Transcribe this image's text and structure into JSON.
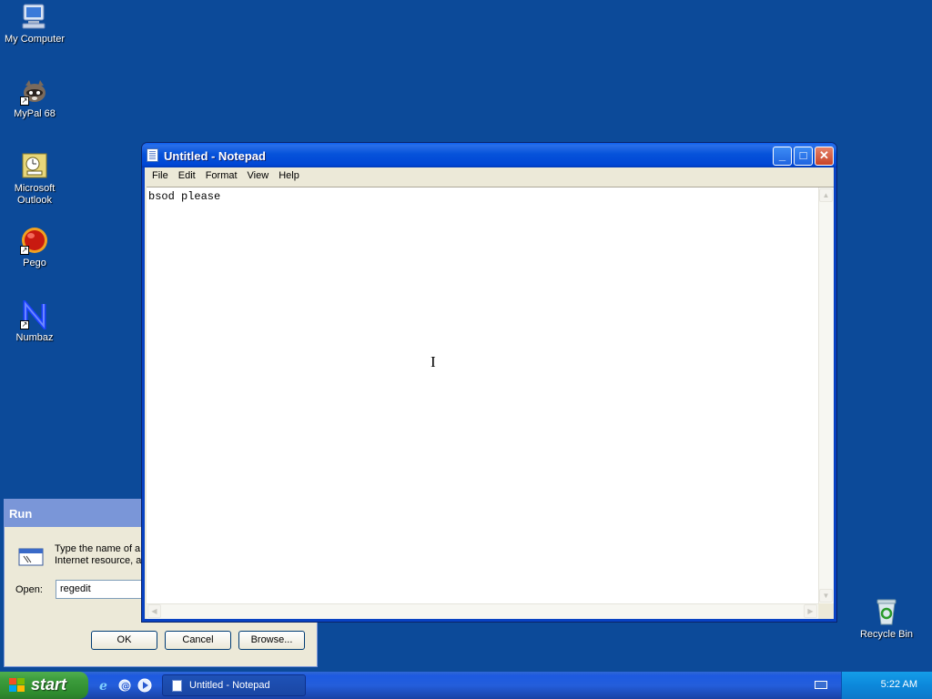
{
  "desktop": {
    "icons": [
      {
        "label": "My Computer"
      },
      {
        "label": "MyPal 68"
      },
      {
        "label": "Microsoft Outlook"
      },
      {
        "label": "Pego"
      },
      {
        "label": "Numbaz"
      },
      {
        "label": "Recycle Bin"
      }
    ]
  },
  "run_dialog": {
    "title": "Run",
    "description_line1": "Type the name of a",
    "description_line2": "Internet resource, a",
    "open_label": "Open:",
    "open_value": "regedit",
    "ok_label": "OK",
    "cancel_label": "Cancel",
    "browse_label": "Browse..."
  },
  "notepad": {
    "title": "Untitled - Notepad",
    "menu": [
      "File",
      "Edit",
      "Format",
      "View",
      "Help"
    ],
    "content": "bsod please"
  },
  "taskbar": {
    "start_label": "start",
    "task_label": "Untitled - Notepad",
    "clock": "5:22 AM"
  }
}
